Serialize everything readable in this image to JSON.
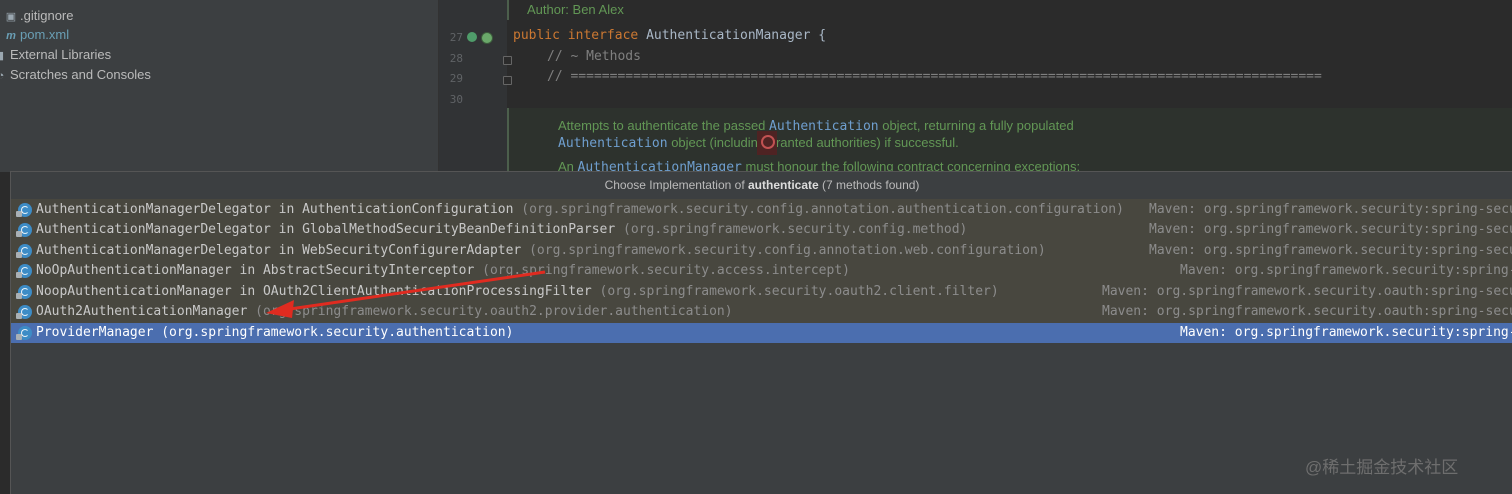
{
  "project_tree": {
    "items": [
      {
        "icon": "gitignore-icon",
        "label": ".gitignore"
      },
      {
        "icon": "maven-icon",
        "label": "pom.xml"
      },
      {
        "icon": "library-icon",
        "label": "External Libraries"
      },
      {
        "icon": "scratches-icon",
        "label": "Scratches and Consoles"
      }
    ]
  },
  "editor": {
    "author": "Author: Ben Alex",
    "lines": [
      {
        "number": "27",
        "text": ""
      },
      {
        "number": "28",
        "text": "// ~ Methods"
      },
      {
        "number": "29",
        "text": "// ================================================================================================"
      },
      {
        "number": "30",
        "text": ""
      }
    ],
    "code_line_27": {
      "kw1": "public",
      "kw2": "interface",
      "rest": "AuthenticationManager {"
    },
    "doc": {
      "line1_a": "Attempts to authenticate the passed ",
      "line1_code": "Authentication",
      "line1_b": " object, returning a fully populated",
      "line2_code": "Authentication",
      "line2_b": " object (including granted authorities) if successful.",
      "line3_a": "An ",
      "line3_code": "AuthenticationManager",
      "line3_b": " must honour the following contract concerning exceptions:"
    }
  },
  "popup": {
    "title_prefix": "Choose Implementation of ",
    "title_method": "authenticate",
    "title_suffix": " (7 methods found)",
    "rows": [
      {
        "name": "AuthenticationManagerDelegator in AuthenticationConfiguration",
        "pkg": "(org.springframework.security.config.annotation.authentication.configuration)",
        "maven": "Maven: org.springframework.security:spring-secu"
      },
      {
        "name": "AuthenticationManagerDelegator in GlobalMethodSecurityBeanDefinitionParser",
        "pkg": "(org.springframework.security.config.method)",
        "maven": "Maven: org.springframework.security:spring-secu"
      },
      {
        "name": "AuthenticationManagerDelegator in WebSecurityConfigurerAdapter",
        "pkg": "(org.springframework.security.config.annotation.web.configuration)",
        "maven": "Maven: org.springframework.security:spring-secu"
      },
      {
        "name": "NoOpAuthenticationManager in AbstractSecurityInterceptor",
        "pkg": "(org.springframework.security.access.intercept)",
        "maven": "Maven: org.springframework.security:spring-"
      },
      {
        "name": "NoopAuthenticationManager in OAuth2ClientAuthenticationProcessingFilter",
        "pkg": "(org.springframework.security.oauth2.client.filter)",
        "maven": "Maven: org.springframework.security.oauth:spring-secu"
      },
      {
        "name": "OAuth2AuthenticationManager",
        "pkg": "(org.springframework.security.oauth2.provider.authentication)",
        "maven": "Maven: org.springframework.security.oauth:spring-secu"
      },
      {
        "name": "ProviderManager",
        "pkg": "(org.springframework.security.authentication)",
        "maven": "Maven: org.springframework.security:spring-"
      }
    ],
    "selected_index": 6
  },
  "annotation": {
    "color": "#e02b20"
  },
  "watermark": "@稀土掘金技术社区"
}
